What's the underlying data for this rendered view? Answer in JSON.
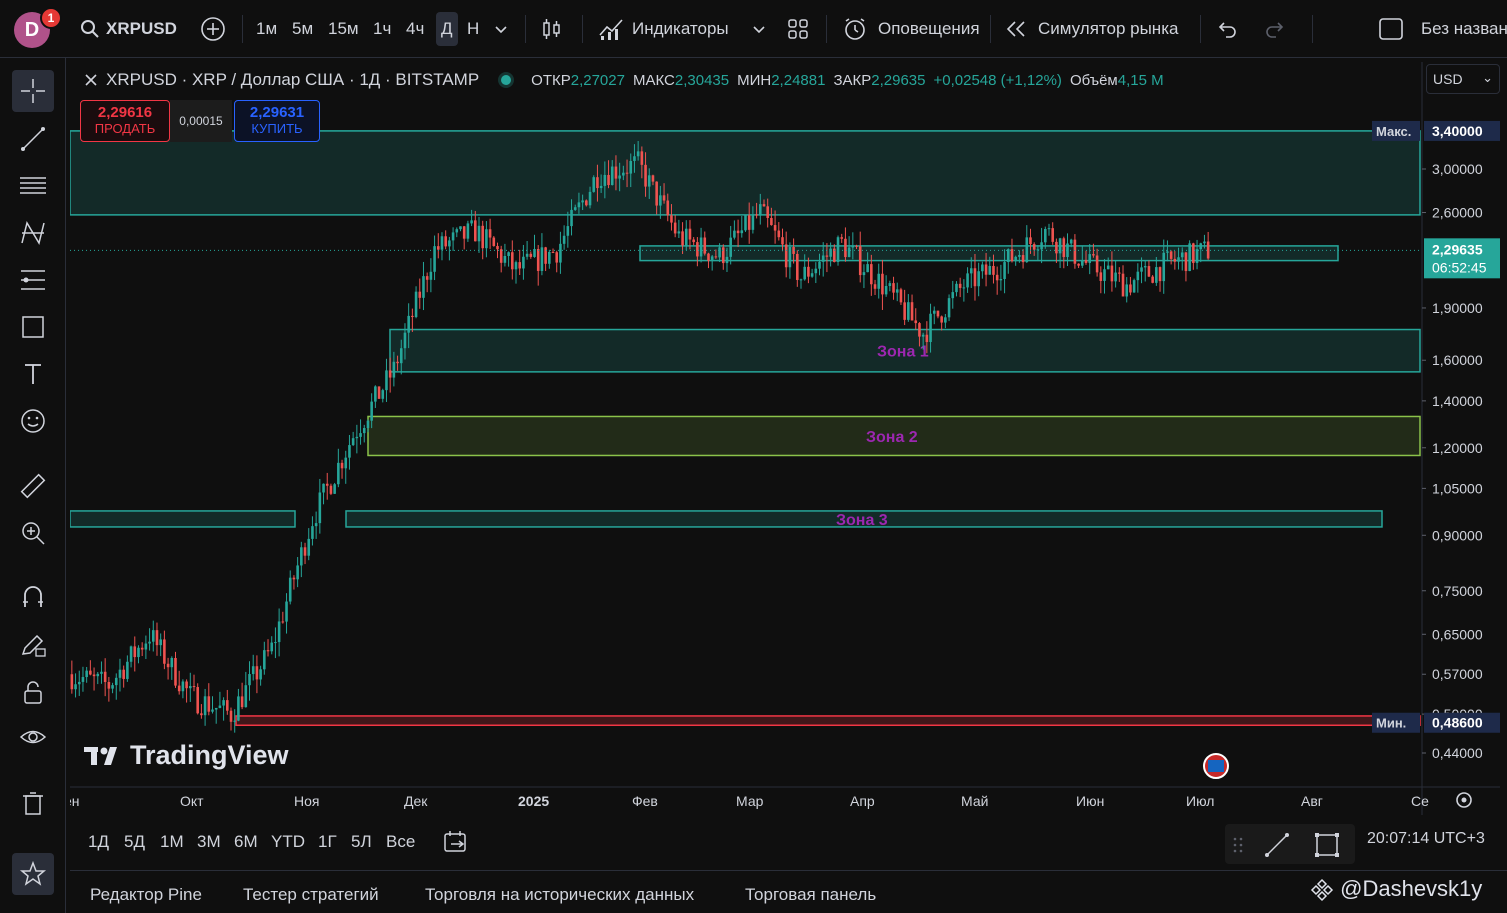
{
  "topbar": {
    "avatar_letter": "D",
    "notifications": "1",
    "symbol": "XRPUSD",
    "intervals": [
      "1м",
      "5м",
      "15м",
      "1ч",
      "4ч",
      "Д",
      "Н"
    ],
    "active_interval": "Д",
    "indicators_label": "Индикаторы",
    "alerts_label": "Оповещения",
    "simulator_label": "Симулятор рынка",
    "layout_name": "Без назван"
  },
  "legend": {
    "title": "XRPUSD · XRP / Доллар США · 1Д · BITSTAMP",
    "open_label": "ОТКР",
    "open": "2,27027",
    "high_label": "МАКС",
    "high": "2,30435",
    "low_label": "МИН",
    "low": "2,24881",
    "close_label": "ЗАКР",
    "close": "2,29635",
    "change": "+0,02548 (+1,12%)",
    "volume_label": "Объём",
    "volume": "4,15 M"
  },
  "trade": {
    "sell_price": "2,29616",
    "sell_label": "ПРОДАТЬ",
    "spread": "0,00015",
    "buy_price": "2,29631",
    "buy_label": "КУПИТЬ"
  },
  "currency": "USD",
  "price_axis": {
    "max_label": "Макс.",
    "max_value": "3,40000",
    "min_label": "Мин.",
    "min_value": "0,48600",
    "last_price": "2,29635",
    "countdown": "06:52:45"
  },
  "brand": "TradingView",
  "ranges": [
    "1Д",
    "5Д",
    "1М",
    "3М",
    "6М",
    "YTD",
    "1Г",
    "5Л",
    "Все"
  ],
  "clock": "20:07:14 UTC+3",
  "bottom_tabs": [
    "Редактор Pine",
    "Тестер стратегий",
    "Торговля на исторических данных",
    "Торговая панель"
  ],
  "watermark": "@Dashevsk1y",
  "colors": {
    "up": "#26a69a",
    "down": "#ef5350",
    "zone_teal": "#26a69a",
    "zone_green": "#8bc34a",
    "zone_red": "#f23645",
    "zone_label": "#9c27b0"
  },
  "chart_data": {
    "type": "candlestick",
    "y_scale": "log",
    "ylim": [
      0.4,
      3.5
    ],
    "y_ticks": [
      3.0,
      2.6,
      1.9,
      1.6,
      1.4,
      1.2,
      1.05,
      0.9,
      0.75,
      0.65,
      0.57,
      0.5,
      0.44
    ],
    "x_ticks": [
      "ен",
      "Окт",
      "Ноя",
      "Дек",
      "2025",
      "Фев",
      "Мар",
      "Апр",
      "Май",
      "Июн",
      "Июл",
      "Авг",
      "Се"
    ],
    "price_path": [
      [
        "Сен",
        0.57
      ],
      [
        "Окт",
        0.55
      ],
      [
        "Окт",
        0.65
      ],
      [
        "Окт",
        0.53
      ],
      [
        "Ноя",
        0.5
      ],
      [
        "Ноя",
        0.62
      ],
      [
        "Ноя",
        0.95
      ],
      [
        "Ноя",
        1.25
      ],
      [
        "Ноя",
        1.55
      ],
      [
        "Дек",
        2.3
      ],
      [
        "Дек",
        2.45
      ],
      [
        "Дек",
        2.15
      ],
      [
        "2025",
        2.3
      ],
      [
        "2025",
        2.95
      ],
      [
        "2025",
        3.05
      ],
      [
        "Фев",
        2.4
      ],
      [
        "Фев",
        2.25
      ],
      [
        "Мар",
        2.6
      ],
      [
        "Мар",
        2.1
      ],
      [
        "Мар",
        2.35
      ],
      [
        "Апр",
        2.05
      ],
      [
        "Апр",
        1.75
      ],
      [
        "Апр",
        2.05
      ],
      [
        "Май",
        2.2
      ],
      [
        "Май",
        2.45
      ],
      [
        "Июн",
        2.2
      ],
      [
        "Июн",
        2.05
      ],
      [
        "Июл",
        2.2
      ],
      [
        "Июл",
        2.29635
      ]
    ],
    "zones": [
      {
        "name": "",
        "top": 3.4,
        "bottom": 2.58,
        "color": "teal"
      },
      {
        "name": "",
        "top": 2.33,
        "bottom": 2.22,
        "color": "teal"
      },
      {
        "name": "Зона 1",
        "top": 1.77,
        "bottom": 1.54,
        "color": "teal"
      },
      {
        "name": "Зона 2",
        "top": 1.33,
        "bottom": 1.17,
        "color": "green"
      },
      {
        "name": "Зона 3",
        "top": 0.975,
        "bottom": 0.925,
        "color": "teal"
      },
      {
        "name": "",
        "top": 0.975,
        "bottom": 0.925,
        "color": "teal"
      },
      {
        "name": "",
        "top": 0.497,
        "bottom": 0.482,
        "color": "red"
      }
    ]
  }
}
